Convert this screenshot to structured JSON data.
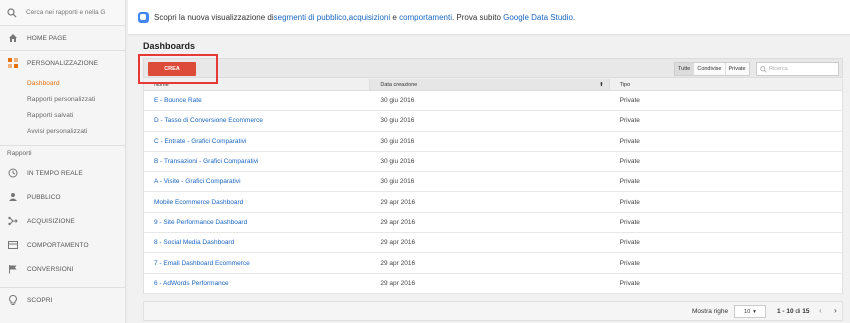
{
  "sidebar": {
    "search_placeholder": "Cerca nei rapporti e nella G",
    "home": "HOME PAGE",
    "customization": "PERSONALIZZAZIONE",
    "sub_items": [
      {
        "label": "Dashboard",
        "active": true
      },
      {
        "label": "Rapporti personalizzati",
        "active": false
      },
      {
        "label": "Rapporti salvati",
        "active": false
      },
      {
        "label": "Avvisi personalizzati",
        "active": false
      }
    ],
    "reports_section": "Rapporti",
    "items": [
      {
        "label": "IN TEMPO REALE",
        "icon": "clock-icon"
      },
      {
        "label": "PUBBLICO",
        "icon": "person-icon"
      },
      {
        "label": "ACQUISIZIONE",
        "icon": "acquisition-icon"
      },
      {
        "label": "COMPORTAMENTO",
        "icon": "behavior-icon"
      },
      {
        "label": "CONVERSIONI",
        "icon": "flag-icon"
      }
    ],
    "discover": "SCOPRI",
    "accent_color": "#e8710a"
  },
  "banner": {
    "prefix": "Scopri la nuova visualizzazione di ",
    "link1": "segmenti di pubblico",
    "sep1": ", ",
    "link2": "acquisizioni",
    "sep2": " e ",
    "link3": "comportamenti",
    "mid": ". Prova subito ",
    "link4": "Google Data Studio",
    "suffix": "."
  },
  "main": {
    "title": "Dashboards",
    "create_label": "CREA",
    "filters": [
      "Tutte",
      "Condivise",
      "Private"
    ],
    "selected_filter": "Tutte",
    "search_placeholder": "Ricerca"
  },
  "table": {
    "headers": [
      "Nome",
      "Data creazione",
      "Tipo"
    ],
    "rows": [
      {
        "name": "E - Bounce Rate",
        "date": "30 giu 2016",
        "type": "Private"
      },
      {
        "name": "D - Tasso di Conversione Ecommerce",
        "date": "30 giu 2016",
        "type": "Private"
      },
      {
        "name": "C - Entrate - Grafici Comparativi",
        "date": "30 giu 2016",
        "type": "Private"
      },
      {
        "name": "B - Transazioni - Grafici Comparativi",
        "date": "30 giu 2016",
        "type": "Private"
      },
      {
        "name": "A - Visite - Grafici Comparativi",
        "date": "30 giu 2016",
        "type": "Private"
      },
      {
        "name": "Mobile Ecommerce Dashboard",
        "date": "29 apr 2016",
        "type": "Private"
      },
      {
        "name": "9 - Site Performance Dashboard",
        "date": "29 apr 2016",
        "type": "Private"
      },
      {
        "name": "8 - Social Media Dashboard",
        "date": "29 apr 2016",
        "type": "Private"
      },
      {
        "name": "7 - Email Dashboard Ecommerce",
        "date": "29 apr 2016",
        "type": "Private"
      },
      {
        "name": "6 - AdWords Performance",
        "date": "29 apr 2016",
        "type": "Private"
      }
    ]
  },
  "footer": {
    "rows_label": "Mostra righe",
    "rows_value": "10",
    "range": "1 - 10",
    "of": " di ",
    "total": "15"
  }
}
